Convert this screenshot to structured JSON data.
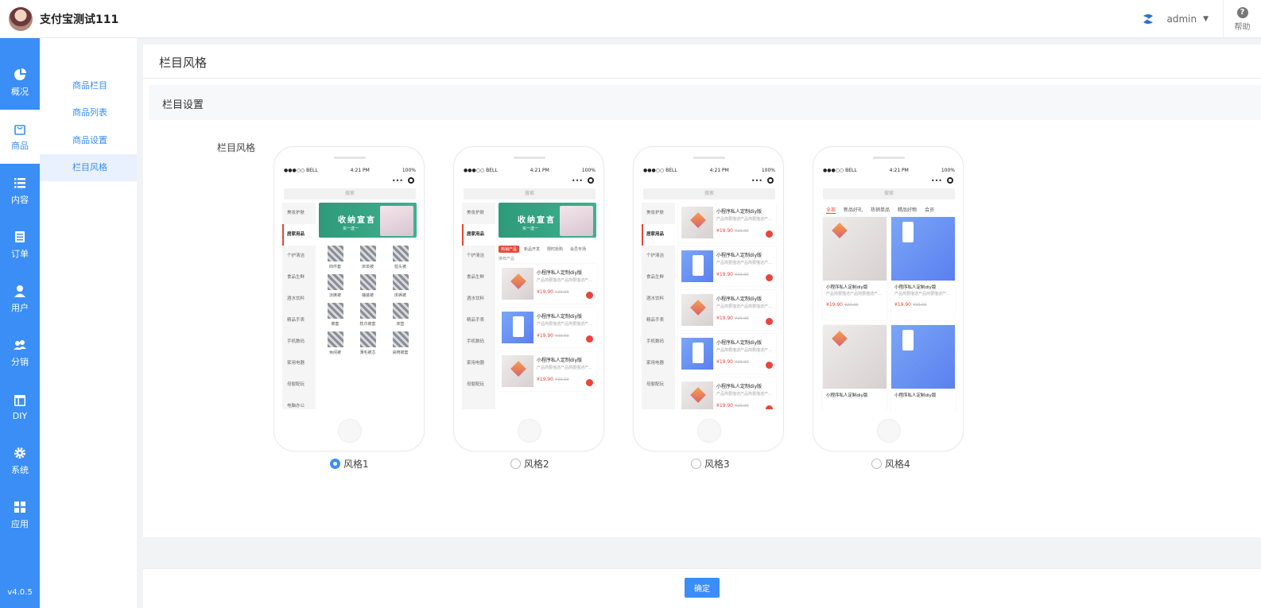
{
  "app": {
    "title": "支付宝测试111"
  },
  "header": {
    "user": "admin",
    "help_label": "帮助"
  },
  "nav": {
    "items": [
      {
        "label": "概况",
        "icon": "pie-chart-icon"
      },
      {
        "label": "商品",
        "icon": "shopping-bag-icon"
      },
      {
        "label": "内容",
        "icon": "list-icon"
      },
      {
        "label": "订单",
        "icon": "document-icon"
      },
      {
        "label": "用户",
        "icon": "user-icon"
      },
      {
        "label": "分销",
        "icon": "users-icon"
      },
      {
        "label": "DIY",
        "icon": "layout-icon"
      },
      {
        "label": "系统",
        "icon": "gear-icon"
      },
      {
        "label": "应用",
        "icon": "grid-icon"
      }
    ],
    "version": "v4.0.5"
  },
  "sub_nav": {
    "items": [
      {
        "label": "商品栏目"
      },
      {
        "label": "商品列表"
      },
      {
        "label": "商品设置"
      },
      {
        "label": "栏目风格"
      }
    ]
  },
  "page": {
    "title": "栏目风格",
    "section_title": "栏目设置",
    "field_label": "栏目风格",
    "confirm_label": "确定"
  },
  "phone": {
    "carrier": "●●●○○ BELL",
    "time": "4:21 PM",
    "battery": "100%",
    "search": "搜索",
    "banner_title": "收纳宣言",
    "banner_sub": "买一送一",
    "categories": [
      "美妆护肤",
      "居家用品",
      "个护清洁",
      "食品生鲜",
      "酒水饮料",
      "精品手表",
      "手机数码",
      "家用电器",
      "母婴配玩",
      "电脑办公"
    ],
    "grid_items": [
      "四件套",
      "床单被",
      "枕头被",
      "凉席被",
      "桶装被",
      "床褥被",
      "被套",
      "枕巾被套",
      "床垫",
      "休闲被",
      "薄毛被芯",
      "桌椅被套"
    ],
    "mini_tabs": [
      "热销产品",
      "新品开发",
      "限时抢购",
      "会员专场"
    ],
    "recommend": "推荐产品",
    "product_title": "小程序私人定制diy版",
    "product_sub": "产品简要描述产品简要描述产...",
    "price": "¥19.90",
    "old_price": "¥29.90",
    "top_tabs": [
      "全部",
      "新品好礼",
      "热销单品",
      "精品好物",
      "会员"
    ]
  },
  "styles": [
    {
      "label": "风格1",
      "checked": true
    },
    {
      "label": "风格2",
      "checked": false
    },
    {
      "label": "风格3",
      "checked": false
    },
    {
      "label": "风格4",
      "checked": false
    }
  ],
  "colors": {
    "primary": "#3a8ef6",
    "accent": "#e9453a",
    "banner": "#2e9a79"
  }
}
